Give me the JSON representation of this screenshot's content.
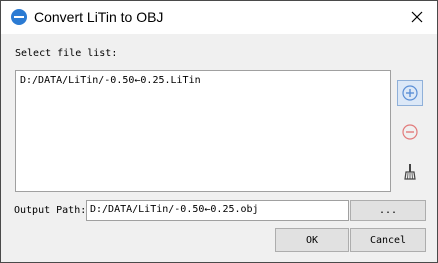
{
  "window": {
    "title": "Convert LiTin to OBJ",
    "logo_icon": "app-logo-icon",
    "close_icon": "close-icon"
  },
  "select": {
    "label": "Select file list:",
    "items": [
      "D:/DATA/LiTin/-0.50←0.25.LiTin"
    ]
  },
  "side_buttons": {
    "add_icon": "plus-circle-icon",
    "remove_icon": "minus-circle-icon",
    "clear_icon": "broom-icon"
  },
  "output": {
    "label": "Output Path:",
    "value": "D:/DATA/LiTin/-0.50←0.25.obj",
    "browse_label": "..."
  },
  "actions": {
    "ok_label": "OK",
    "cancel_label": "Cancel"
  },
  "colors": {
    "add_icon": "#5b8fd6",
    "remove_icon": "#e27a7a"
  }
}
